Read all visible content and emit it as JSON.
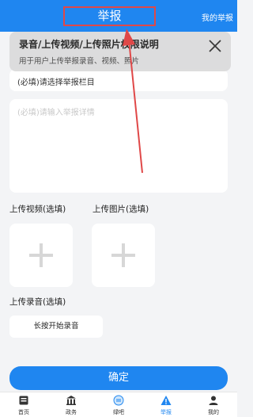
{
  "header": {
    "title": "举报",
    "right_link": "我的举报"
  },
  "permission_banner": {
    "title": "录音/上传视频/上传照片权限说明",
    "description": "用于用户上传举报录音、视频、照片"
  },
  "form": {
    "column_placeholder": "(必填)请选择举报栏目",
    "details_placeholder": "(必填)请输入举报详情",
    "video_label": "上传视频(选填)",
    "image_label": "上传图片(选填)",
    "audio_label": "上传录音(选填)",
    "record_button": "长按开始录音",
    "confirm_button": "确定"
  },
  "tabbar": {
    "items": [
      {
        "label": "首页",
        "icon": "home-icon"
      },
      {
        "label": "政务",
        "icon": "government-building-icon"
      },
      {
        "label": "绿吧",
        "icon": "chat-bubble-icon"
      },
      {
        "label": "举报",
        "icon": "warning-icon",
        "active": true
      },
      {
        "label": "我的",
        "icon": "person-icon"
      }
    ]
  },
  "colors": {
    "primary": "#1f86f0",
    "annotation": "#e04848"
  }
}
